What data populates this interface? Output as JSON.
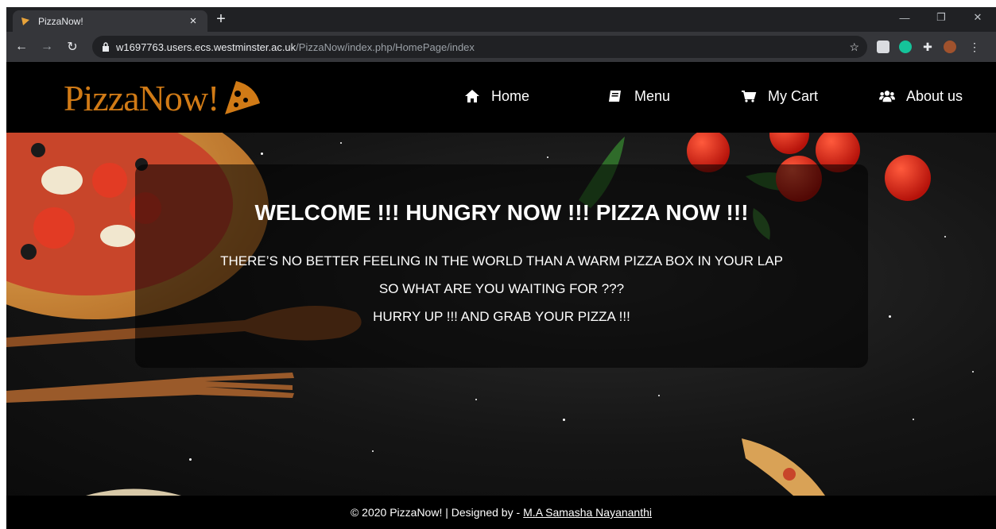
{
  "browser": {
    "tab_title": "PizzaNow!",
    "tab_close": "×",
    "new_tab": "+",
    "url_host": "w1697763.users.ecs.westminster.ac.uk",
    "url_path": "/PizzaNow/index.php/HomePage/index"
  },
  "site": {
    "logo_text": "PizzaNow!",
    "nav": [
      {
        "label": "Home",
        "icon": "home-icon"
      },
      {
        "label": "Menu",
        "icon": "book-icon"
      },
      {
        "label": "My Cart",
        "icon": "cart-icon"
      },
      {
        "label": "About us",
        "icon": "users-icon"
      }
    ],
    "hero": {
      "heading": "WELCOME !!! HUNGRY NOW !!! PIZZA NOW !!!",
      "line1": "THERE’S NO BETTER FEELING IN THE WORLD THAN A WARM PIZZA BOX IN YOUR LAP",
      "line2": "SO WHAT ARE YOU WAITING FOR ???",
      "line3": "HURRY UP !!! AND GRAB YOUR PIZZA !!!"
    },
    "footer": {
      "text": "© 2020 PizzaNow! | Designed by -",
      "link": "M.A Samasha Nayananthi"
    }
  },
  "colors": {
    "brand": "#d07a16",
    "chrome_dark": "#202124",
    "chrome_mid": "#35363a"
  }
}
